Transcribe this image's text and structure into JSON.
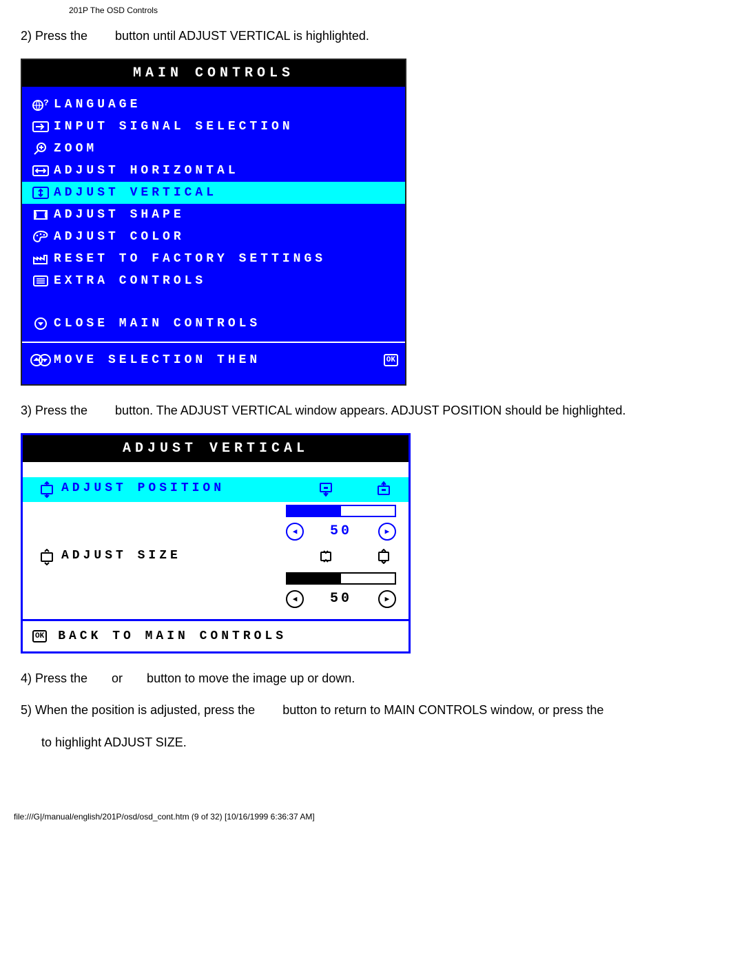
{
  "header": "201P The OSD Controls",
  "step2": "2) Press the        button until ADJUST VERTICAL is highlighted.",
  "step3": "3) Press the        button. The ADJUST VERTICAL window appears. ADJUST POSITION should be highlighted.",
  "step4": "4) Press the       or       button to move the image up or down.",
  "step5": "5) When the position is adjusted, press the        button to return to MAIN CONTROLS window, or press the",
  "step5b": "to highlight ADJUST SIZE.",
  "osd1": {
    "title": "MAIN CONTROLS",
    "items": [
      {
        "label": "LANGUAGE"
      },
      {
        "label": "INPUT SIGNAL SELECTION"
      },
      {
        "label": "ZOOM"
      },
      {
        "label": "ADJUST HORIZONTAL"
      },
      {
        "label": "ADJUST VERTICAL"
      },
      {
        "label": "ADJUST SHAPE"
      },
      {
        "label": "ADJUST COLOR"
      },
      {
        "label": "RESET TO FACTORY SETTINGS"
      },
      {
        "label": "EXTRA CONTROLS"
      }
    ],
    "close": "CLOSE MAIN CONTROLS",
    "hint": "MOVE SELECTION THEN",
    "ok": "OK"
  },
  "osd2": {
    "title": "ADJUST VERTICAL",
    "position": {
      "label": "ADJUST POSITION",
      "value": "50"
    },
    "size": {
      "label": "ADJUST SIZE",
      "value": "50"
    },
    "back": "BACK TO MAIN CONTROLS",
    "ok": "OK"
  },
  "footer": "file:///G|/manual/english/201P/osd/osd_cont.htm (9 of 32) [10/16/1999 6:36:37 AM]"
}
